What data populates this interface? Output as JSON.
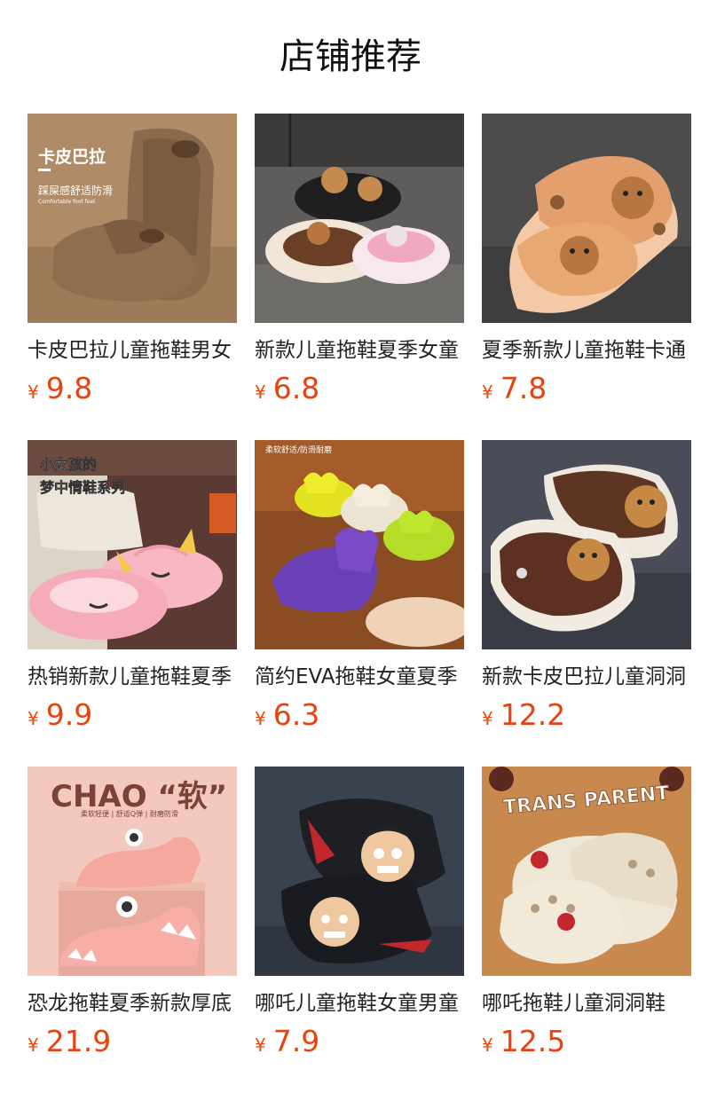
{
  "page": {
    "title": "店铺推荐"
  },
  "currency_symbol": "¥",
  "colors": {
    "price": "#e8430f",
    "title": "#111111"
  },
  "products": [
    {
      "name": "卡皮巴拉儿童拖鞋男女",
      "price": "9.8",
      "image": {
        "icon": "capybara-slide-brown",
        "overlay": [
          "卡皮巴拉",
          "踩屎感舒适防滑",
          "Comfortable foot feel"
        ]
      }
    },
    {
      "name": "新款儿童拖鞋夏季女童",
      "price": "6.8",
      "image": {
        "icon": "bear-sandals-black-pink",
        "overlay": []
      }
    },
    {
      "name": "夏季新款儿童拖鞋卡通",
      "price": "7.8",
      "image": {
        "icon": "capybara-print-slides",
        "overlay": []
      }
    },
    {
      "name": "热销新款儿童拖鞋夏季",
      "price": "9.9",
      "image": {
        "icon": "unicorn-pink-slides",
        "overlay": [
          "小女孩的",
          "梦中情鞋系列"
        ]
      }
    },
    {
      "name": "简约EVA拖鞋女童夏季",
      "price": "6.3",
      "image": {
        "icon": "eva-slides-colorful",
        "overlay": [
          "柔软舒适/防滑耐磨"
        ]
      }
    },
    {
      "name": "新款卡皮巴拉儿童洞洞",
      "price": "12.2",
      "image": {
        "icon": "capybara-clog-brown",
        "overlay": []
      }
    },
    {
      "name": "恐龙拖鞋夏季新款厚底",
      "price": "21.9",
      "image": {
        "icon": "dinosaur-pink-slides",
        "overlay": [
          "CHAO “软”",
          "柔软轻便 | 舒适Q弹 | 耐磨防滑"
        ]
      }
    },
    {
      "name": "哪吒儿童拖鞋女童男童",
      "price": "7.9",
      "image": {
        "icon": "nezha-black-slides",
        "overlay": []
      }
    },
    {
      "name": "哪吒拖鞋儿童洞洞鞋",
      "price": "12.5",
      "image": {
        "icon": "nezha-beige-clogs",
        "overlay": [
          "TRANS PARENT"
        ]
      }
    }
  ]
}
